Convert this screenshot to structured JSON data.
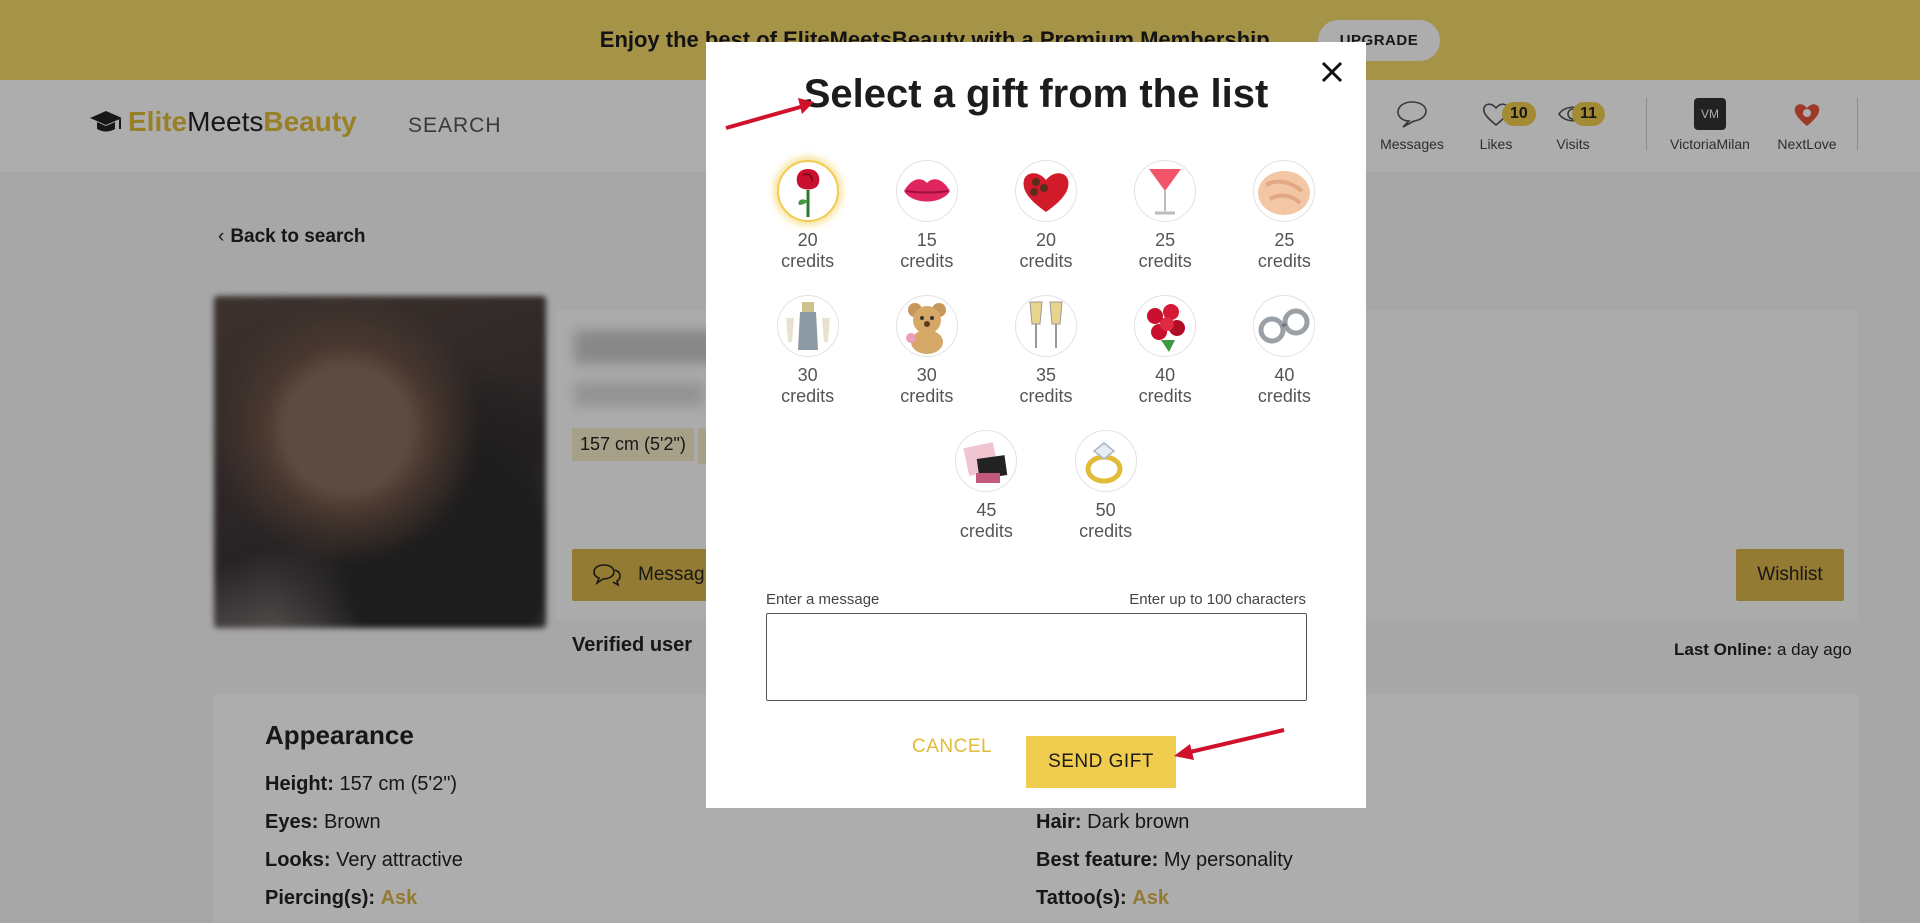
{
  "promo": {
    "text": "Enjoy the best of EliteMeetsBeauty with a Premium Membership",
    "button": "UPGRADE"
  },
  "brand": {
    "part1": "Elite",
    "part2": "Meets",
    "part3": "Beauty"
  },
  "nav": {
    "search": "SEARCH",
    "messages": "Messages",
    "likes": "Likes",
    "likes_count": "10",
    "visits": "Visits",
    "visits_count": "11",
    "victoriamilan": "VictoriaMilan",
    "vm_initials": "VM",
    "nextlove": "NextLove"
  },
  "profile": {
    "back": "Back to search",
    "height_chip": "157 cm (5'2\")",
    "message_btn": "Messag",
    "wishlist_btn": "Wishlist",
    "verified": "Verified user",
    "last_online_label": "Last Online:",
    "last_online_value": "a day ago"
  },
  "appearance": {
    "title": "Appearance",
    "height_label": "Height:",
    "height_value": "157 cm (5'2\")",
    "eyes_label": "Eyes:",
    "eyes_value": "Brown",
    "looks_label": "Looks:",
    "looks_value": "Very attractive",
    "piercing_label": "Piercing(s):",
    "piercing_value": "Ask",
    "hair_label": "Hair:",
    "hair_value": "Dark brown",
    "feature_label": "Best feature:",
    "feature_value": "My personality",
    "tattoo_label": "Tattoo(s):",
    "tattoo_value": "Ask"
  },
  "modal": {
    "title": "Select a gift from the list",
    "gifts": [
      {
        "price": "20",
        "unit": "credits",
        "icon": "rose-icon",
        "selected": true
      },
      {
        "price": "15",
        "unit": "credits",
        "icon": "kiss-lips-icon"
      },
      {
        "price": "20",
        "unit": "credits",
        "icon": "heart-chocolates-icon"
      },
      {
        "price": "25",
        "unit": "credits",
        "icon": "cocktail-icon"
      },
      {
        "price": "25",
        "unit": "credits",
        "icon": "massage-icon"
      },
      {
        "price": "30",
        "unit": "credits",
        "icon": "champagne-bottle-icon"
      },
      {
        "price": "30",
        "unit": "credits",
        "icon": "teddy-bear-icon"
      },
      {
        "price": "35",
        "unit": "credits",
        "icon": "champagne-glasses-icon"
      },
      {
        "price": "40",
        "unit": "credits",
        "icon": "roses-bouquet-icon"
      },
      {
        "price": "40",
        "unit": "credits",
        "icon": "handcuffs-icon"
      },
      {
        "price": "45",
        "unit": "credits",
        "icon": "lingerie-icon"
      },
      {
        "price": "50",
        "unit": "credits",
        "icon": "diamond-ring-icon"
      }
    ],
    "message_label": "Enter a message",
    "message_hint": "Enter up to 100 characters",
    "message_placeholder": "",
    "cancel": "CANCEL",
    "send": "SEND GIFT"
  },
  "colors": {
    "accent": "#f1cd4f",
    "gold_text": "#e2bb38",
    "arrow": "#d0112b"
  }
}
